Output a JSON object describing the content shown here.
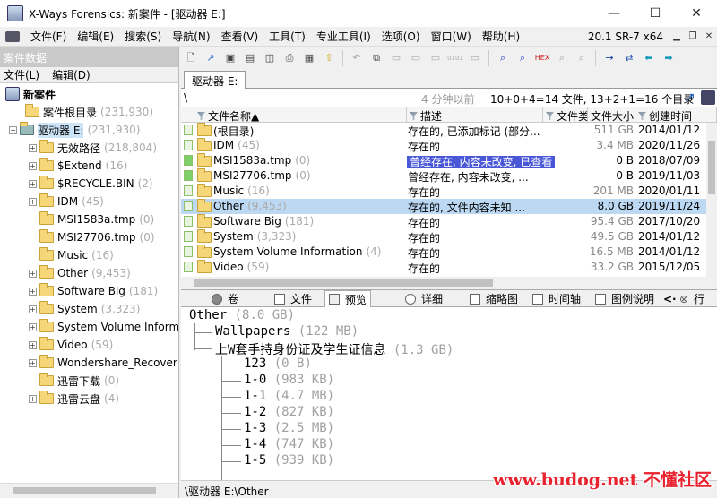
{
  "window": {
    "title": "X-Ways Forensics: 新案件 - [驱动器 E:]",
    "minimize": "—",
    "maximize": "☐",
    "close": "✕"
  },
  "menubar": {
    "items": [
      "文件(F)",
      "编辑(E)",
      "搜索(S)",
      "导航(N)",
      "查看(V)",
      "工具(T)",
      "专业工具(I)",
      "选项(O)",
      "窗口(W)",
      "帮助(H)"
    ],
    "version": "20.1 SR-7 x64"
  },
  "left_panel": {
    "header": "案件数据",
    "menu": [
      "文件(L)",
      "编辑(D)"
    ],
    "tree": [
      {
        "label": "新案件",
        "count": ""
      },
      {
        "label": "案件根目录",
        "count": "(231,930)"
      },
      {
        "label": "驱动器 E:",
        "count": "(231,930)"
      },
      {
        "label": "无效路径",
        "count": "(218,804)"
      },
      {
        "label": "$Extend",
        "count": "(16)"
      },
      {
        "label": "$RECYCLE.BIN",
        "count": "(2)"
      },
      {
        "label": "IDM",
        "count": "(45)"
      },
      {
        "label": "MSI1583a.tmp",
        "count": "(0)"
      },
      {
        "label": "MSI27706.tmp",
        "count": "(0)"
      },
      {
        "label": "Music",
        "count": "(16)"
      },
      {
        "label": "Other",
        "count": "(9,453)"
      },
      {
        "label": "Software Big",
        "count": "(181)"
      },
      {
        "label": "System",
        "count": "(3,323)"
      },
      {
        "label": "System Volume Inform",
        "count": ""
      },
      {
        "label": "Video",
        "count": "(59)"
      },
      {
        "label": "Wondershare_Recover",
        "count": ""
      },
      {
        "label": "迅雷下载",
        "count": "(0)"
      },
      {
        "label": "迅雷云盘",
        "count": "(4)"
      }
    ]
  },
  "tab": {
    "label": "驱动器 E:"
  },
  "pathbar": {
    "path": "\\",
    "ago": "4 分钟以前",
    "stats": "10+0+4=14 文件, 13+2+1=16 个目录"
  },
  "filelist": {
    "columns": [
      "文件名称",
      "描述",
      "文件类",
      "文件大小",
      "创建时间"
    ],
    "rows": [
      {
        "name": "(根目录)",
        "count": "",
        "desc": "存在的, 已添加标记 (部分...",
        "size": "511 GB",
        "created": "2014/01/12"
      },
      {
        "name": "IDM",
        "count": "(45)",
        "desc": "存在的",
        "size": "3.4 MB",
        "created": "2020/11/26"
      },
      {
        "name": "MSI1583a.tmp",
        "count": "(0)",
        "desc": "曾经存在, 内容未改变, 已查看",
        "size": "0 B",
        "created": "2018/07/09"
      },
      {
        "name": "MSI27706.tmp",
        "count": "(0)",
        "desc": "曾经存在, 内容未改变, ...",
        "size": "0 B",
        "created": "2019/11/03"
      },
      {
        "name": "Music",
        "count": "(16)",
        "desc": "存在的",
        "size": "201 MB",
        "created": "2020/01/11"
      },
      {
        "name": "Other",
        "count": "(9,453)",
        "desc": "存在的, 文件内容未知 ...",
        "size": "8.0 GB",
        "created": "2019/11/24"
      },
      {
        "name": "Software Big",
        "count": "(181)",
        "desc": "存在的",
        "size": "95.4 GB",
        "created": "2017/10/20"
      },
      {
        "name": "System",
        "count": "(3,323)",
        "desc": "存在的",
        "size": "49.5 GB",
        "created": "2014/01/12"
      },
      {
        "name": "System Volume Information",
        "count": "(4)",
        "desc": "存在的",
        "size": "16.5 MB",
        "created": "2014/01/12"
      },
      {
        "name": "Video",
        "count": "(59)",
        "desc": "存在的",
        "size": "33.2 GB",
        "created": "2015/12/05"
      }
    ]
  },
  "view_tabs": [
    "卷",
    "文件",
    "预览",
    "详细",
    "缩略图",
    "时间轴",
    "图例说明",
    "行"
  ],
  "preview": {
    "root": {
      "name": "Other",
      "size": "(8.0 GB)"
    },
    "items": [
      {
        "name": "Wallpapers",
        "size": "(122 MB)"
      },
      {
        "name": "上W套手持身份证及学生证信息",
        "size": "(1.3 GB)"
      },
      {
        "name": "123",
        "size": "(0 B)"
      },
      {
        "name": "1-0",
        "size": "(983 KB)"
      },
      {
        "name": "1-1",
        "size": "(4.7 MB)"
      },
      {
        "name": "1-2",
        "size": "(827 KB)"
      },
      {
        "name": "1-3",
        "size": "(2.5 MB)"
      },
      {
        "name": "1-4",
        "size": "(747 KB)"
      },
      {
        "name": "1-5",
        "size": "(939 KB)"
      }
    ]
  },
  "statusbar": {
    "path": "\\驱动器 E:\\Other"
  },
  "watermark": "www.budog.net 不懂社区"
}
